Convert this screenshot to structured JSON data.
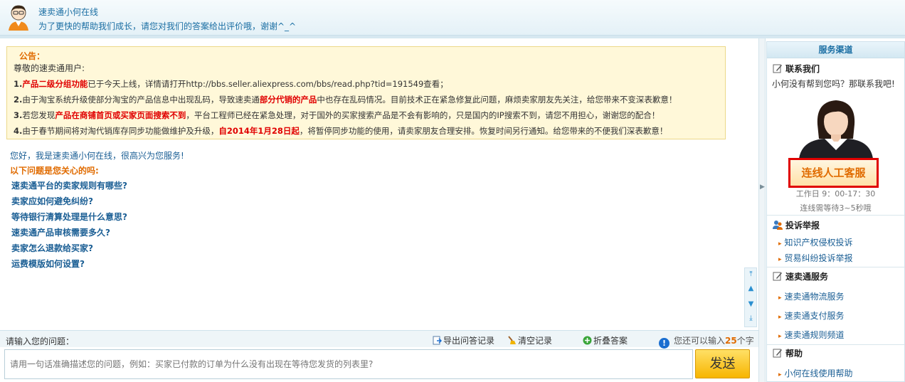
{
  "header": {
    "name": "速卖通小何在线",
    "subtitle": "为了更快的帮助我们成长，请您对我们的答案给出评价哦，谢谢^_^"
  },
  "notice": {
    "title": "公告：",
    "greeting": "尊敬的速卖通用户:",
    "line1": {
      "num": "1.",
      "highlight": "产品二级分组功能",
      "text": "已于今天上线，详情请打开http://bbs.seller.aliexpress.com/bbs/read.php?tid=191549查看；"
    },
    "line2": {
      "num": "2.",
      "pre": "由于淘宝系统升级使部分淘宝的产品信息中出现乱码，导致速卖通",
      "highlight": "部分代销的产品",
      "post": "中也存在乱码情况。目前技术正在紧急修复此问题，麻烦卖家朋友先关注，给您带来不变深表歉意！"
    },
    "line3": {
      "num": "3.",
      "pre": "若您发现",
      "highlight": "产品在商铺首页或买家页面搜索不到",
      "post": "，平台工程师已经在紧急处理，对于国外的买家搜索产品是不会有影响的，只是国内的IP搜索不到，请您不用担心，谢谢您的配合！"
    },
    "line4": {
      "num": "4.",
      "pre": "由于春节期间将对淘代销库存同步功能做维护及升级，",
      "highlight": "自2014年1月28日起",
      "post": "，将暂停同步功能的使用，请卖家朋友合理安排。恢复时间另行通知。给您带来的不便我们深表歉意！"
    }
  },
  "chat": {
    "welcome": "您好，我是速卖通小何在线，很高兴为您服务!",
    "faq_head": "以下问题是您关心的吗:",
    "faq": [
      "速卖通平台的卖家规则有哪些?",
      "卖家应如何避免纠纷?",
      "等待银行清算处理是什么意思?",
      "速卖通产品审核需要多久?",
      "卖家怎么退款给买家?",
      "运费模版如何设置?"
    ]
  },
  "input": {
    "label": "请输入您的问题：",
    "export_label": "导出问答记录",
    "clear_label": "清空记录",
    "collapse_label": "折叠答案",
    "counter_pre": "您还可以输入",
    "counter_num": "25",
    "counter_post": "个字",
    "placeholder": "请用一句话准确描述您的问题，例如：买家已付款的订单为什么没有出现在等待您发货的列表里?",
    "send_label": "发送"
  },
  "sidebar": {
    "title": "服务渠道",
    "contact": {
      "title": "联系我们",
      "text": "小何没有帮到您吗？那联系我吧!",
      "button": "连线人工客服",
      "hours": "工作日 9：00-17：30",
      "wait": "连线需等待3~5秒哦"
    },
    "complaint": {
      "title": "投诉举报",
      "links": [
        "知识产权侵权投诉",
        "贸易纠纷投诉举报"
      ]
    },
    "services": {
      "title": "速卖通服务",
      "links": [
        "速卖通物流服务",
        "速卖通支付服务",
        "速卖通规则频道"
      ]
    },
    "help": {
      "title": "帮助",
      "links": [
        "小何在线使用帮助"
      ]
    }
  },
  "colors": {
    "accent": "#1a6ea3",
    "orange": "#e06b00",
    "red": "#e00000",
    "notice_bg": "#fff8d9"
  }
}
